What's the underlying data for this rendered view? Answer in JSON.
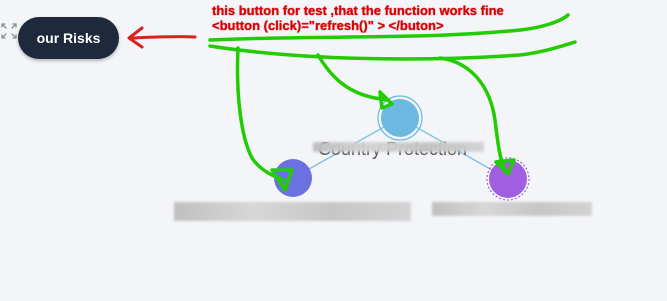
{
  "toolbar": {
    "risks_button_label": "our Risks"
  },
  "annotation": {
    "line1": "this button for test ,that the function works fine",
    "line2": "<button (click)=\"refresh()\" > </buton>"
  },
  "graph": {
    "center_node": {
      "label": "Country Protection",
      "color": "#6cb8e0"
    },
    "left_node": {
      "color": "#6b72e0"
    },
    "right_node": {
      "color": "#a05ee0"
    }
  },
  "colors": {
    "annotation_red": "#e00000",
    "arrow_red": "#e02020",
    "scribble_green": "#22cc00",
    "edge_blue": "#7fbfe0",
    "button_bg": "#1e293b"
  }
}
